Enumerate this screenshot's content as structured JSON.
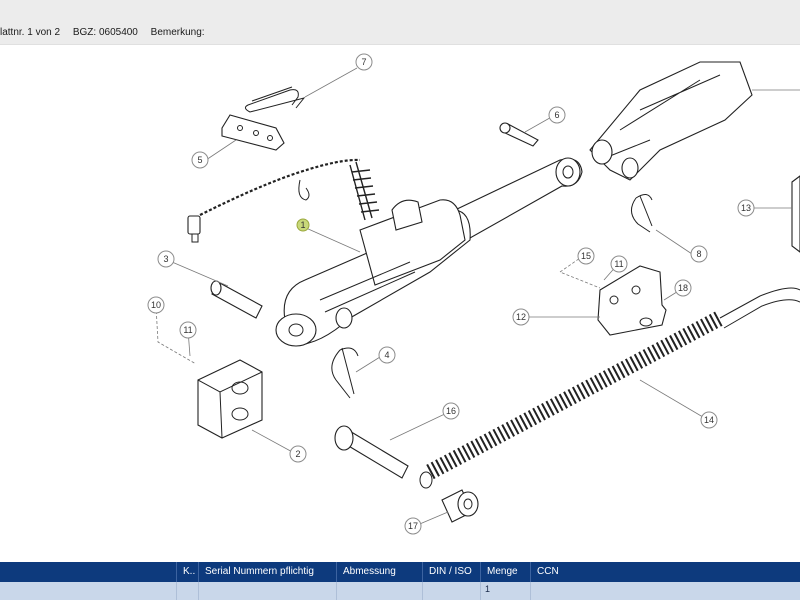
{
  "header": {
    "sheet": "lattnr. 1 von 2",
    "bgz": "BGZ: 0605400",
    "remark": "Bemerkung:"
  },
  "callouts": [
    "1",
    "2",
    "3",
    "4",
    "5",
    "6",
    "7",
    "8",
    "10",
    "11",
    "11",
    "12",
    "13",
    "14",
    "15",
    "16",
    "17",
    "18"
  ],
  "table": {
    "columns": [
      "K..",
      "Serial Nummern pflichtig",
      "Abmessung",
      "DIN / ISO",
      "Menge",
      "CCN"
    ],
    "row": {
      "menge": "1"
    }
  },
  "colors": {
    "header_bg": "#0d3a7d",
    "row_bg": "#c9d7ea",
    "highlight": "#c8d87a"
  }
}
